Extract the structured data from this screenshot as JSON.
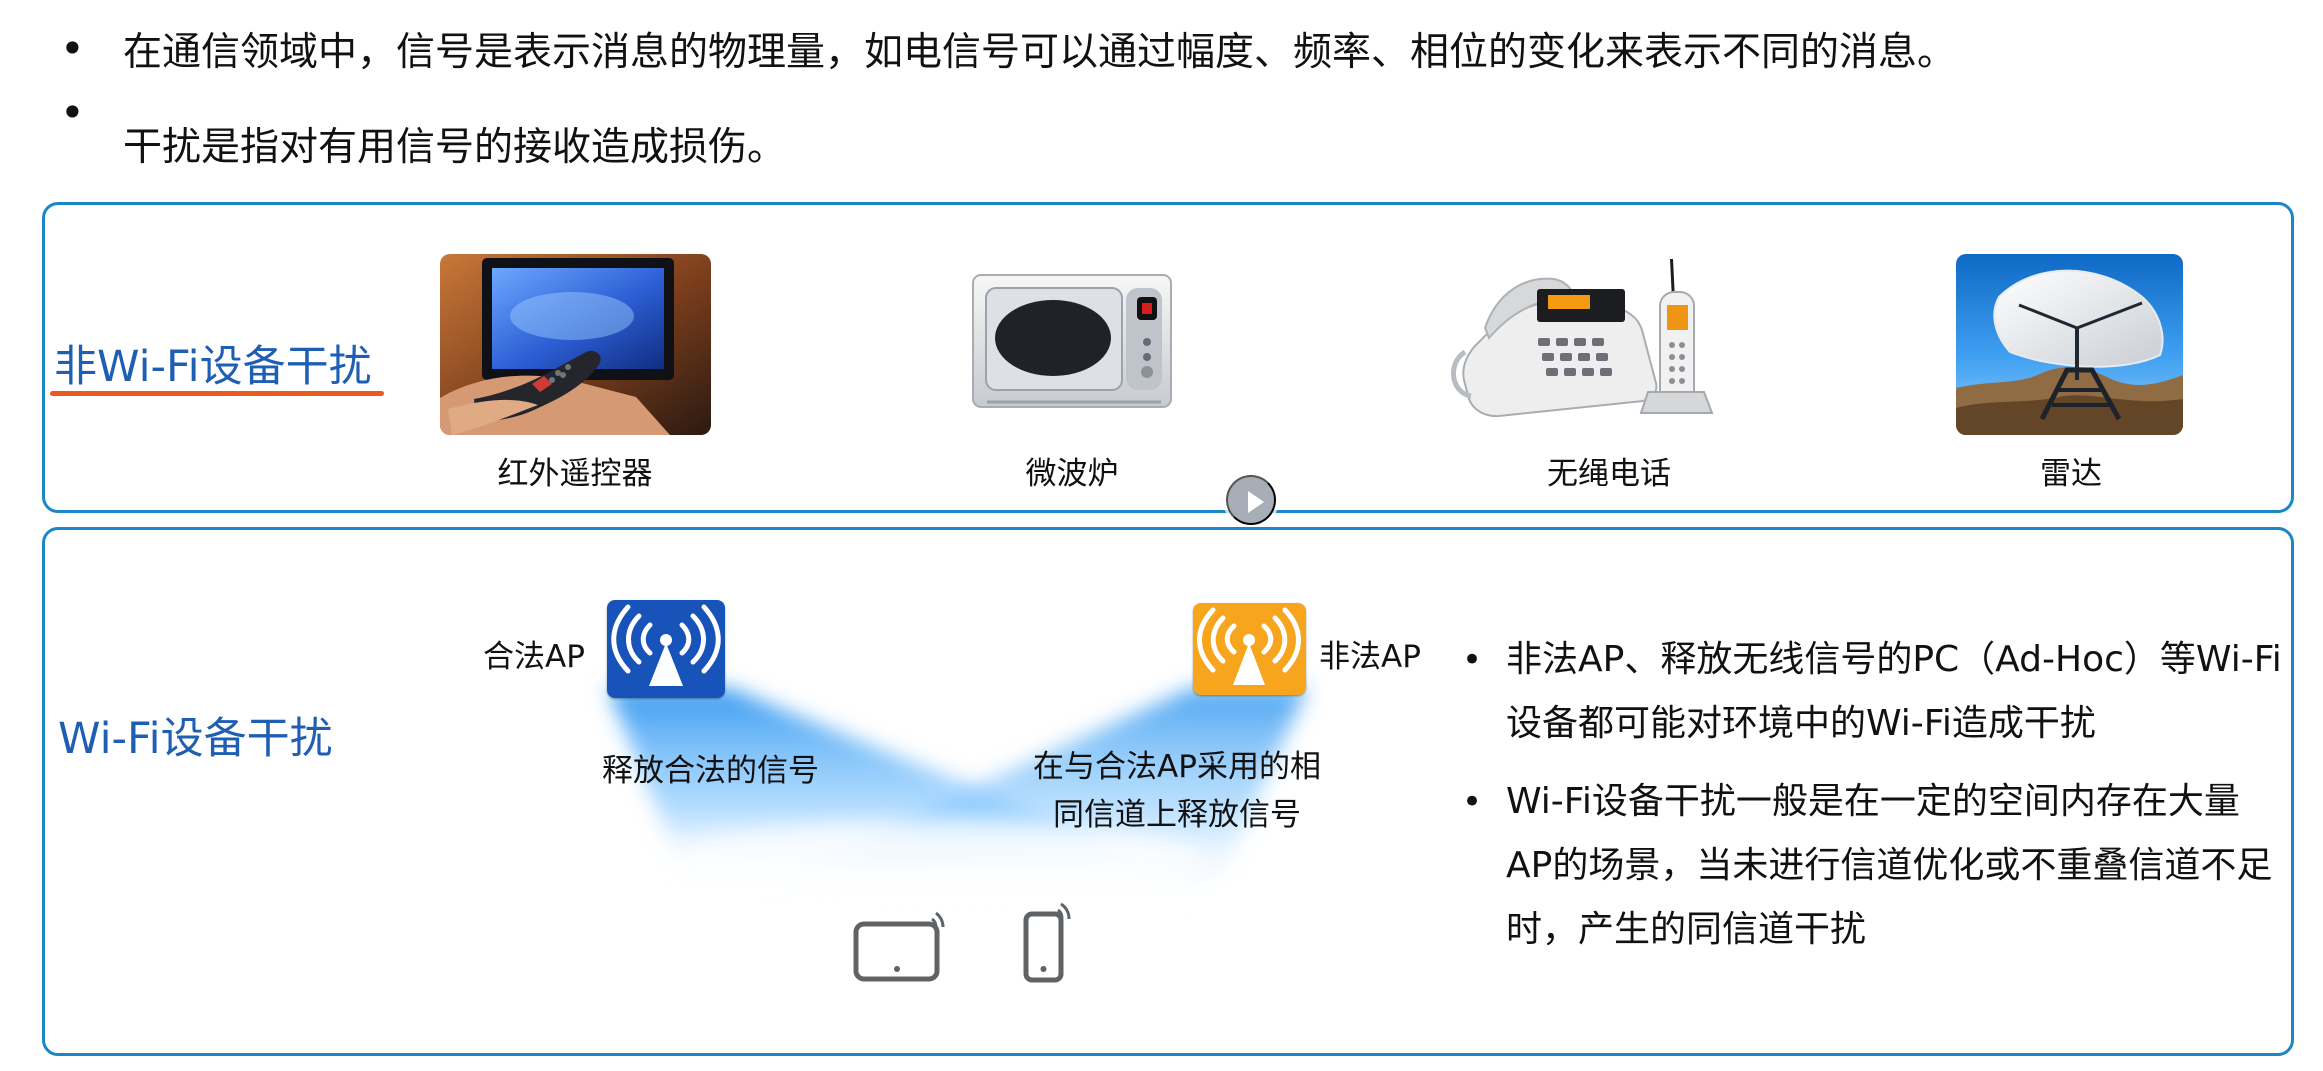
{
  "bullets": [
    "在通信领域中，信号是表示消息的物理量，如电信号可以通过幅度、频率、相位的变化来表示不同的消息。",
    "干扰是指对有用信号的接收造成损伤。"
  ],
  "non_wifi_panel": {
    "title": "非Wi-Fi设备干扰",
    "devices": [
      {
        "label": "红外遥控器",
        "icon": "remote-control-tv-photo"
      },
      {
        "label": "微波炉",
        "icon": "microwave-photo"
      },
      {
        "label": "无绳电话",
        "icon": "cordless-phone-photo"
      },
      {
        "label": "雷达",
        "icon": "radar-dish-photo"
      }
    ]
  },
  "player": {
    "icon": "play-icon"
  },
  "wifi_panel": {
    "title": "Wi-Fi设备干扰",
    "legal_ap": "合法AP",
    "illegal_ap": "非法AP",
    "legal_signal": "释放合法的信号",
    "illegal_signal_line1": "在与合法AP采用的相",
    "illegal_signal_line2": "同信道上释放信号",
    "notes": [
      "非法AP、释放无线信号的PC（Ad-Hoc）等Wi-Fi设备都可能对环境中的Wi-Fi造成干扰",
      "Wi-Fi设备干扰一般是在一定的空间内存在大量AP的场景，当未进行信道优化或不重叠信道不足时，产生的同信道干扰"
    ],
    "client_icons": [
      "tablet-icon",
      "phone-icon"
    ]
  },
  "colors": {
    "panel_border": "#1c86c8",
    "panel_title": "#1f5fb3",
    "underline": "#ea5b1f",
    "legal_ap": "#1753b8",
    "illegal_ap": "#f6a51d",
    "beam": "#46a7f2"
  }
}
